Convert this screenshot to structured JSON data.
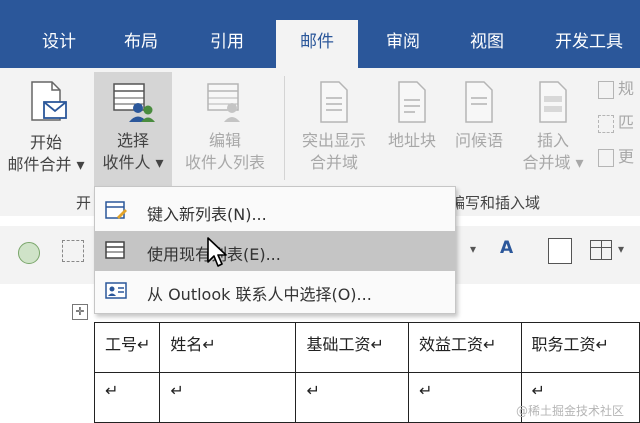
{
  "tabs": [
    {
      "label": "设计"
    },
    {
      "label": "布局"
    },
    {
      "label": "引用"
    },
    {
      "label": "邮件"
    },
    {
      "label": "审阅"
    },
    {
      "label": "视图"
    },
    {
      "label": "开发工具"
    }
  ],
  "ribbon": {
    "start_merge": {
      "line1": "开始",
      "line2": "邮件合并 ▾"
    },
    "select_recipients": {
      "line1": "选择",
      "line2": "收件人 ▾"
    },
    "edit_list": {
      "line1": "编辑",
      "line2": "收件人列表"
    },
    "highlight_fields": {
      "line1": "突出显示",
      "line2": "合并域"
    },
    "address_block": {
      "line1": "地址块"
    },
    "greeting_line": {
      "line1": "问候语"
    },
    "insert_field": {
      "line1": "插入",
      "line2": "合并域 ▾"
    },
    "right_partial": [
      "规",
      "匹",
      "更"
    ],
    "group_left_label": "开",
    "group_write_label": "编写和插入域"
  },
  "menu": {
    "items": [
      {
        "label": "键入新列表(N)..."
      },
      {
        "label": "使用现有列表(E)..."
      },
      {
        "label": "从 Outlook 联系人中选择(O)..."
      }
    ]
  },
  "table": {
    "headers": [
      "工号↵",
      "姓名↵",
      "基础工资↵",
      "效益工资↵",
      "职务工资↵"
    ],
    "row1": [
      "↵",
      "↵",
      "↵",
      "↵",
      "↵"
    ]
  },
  "watermark": "@稀土掘金技术社区"
}
